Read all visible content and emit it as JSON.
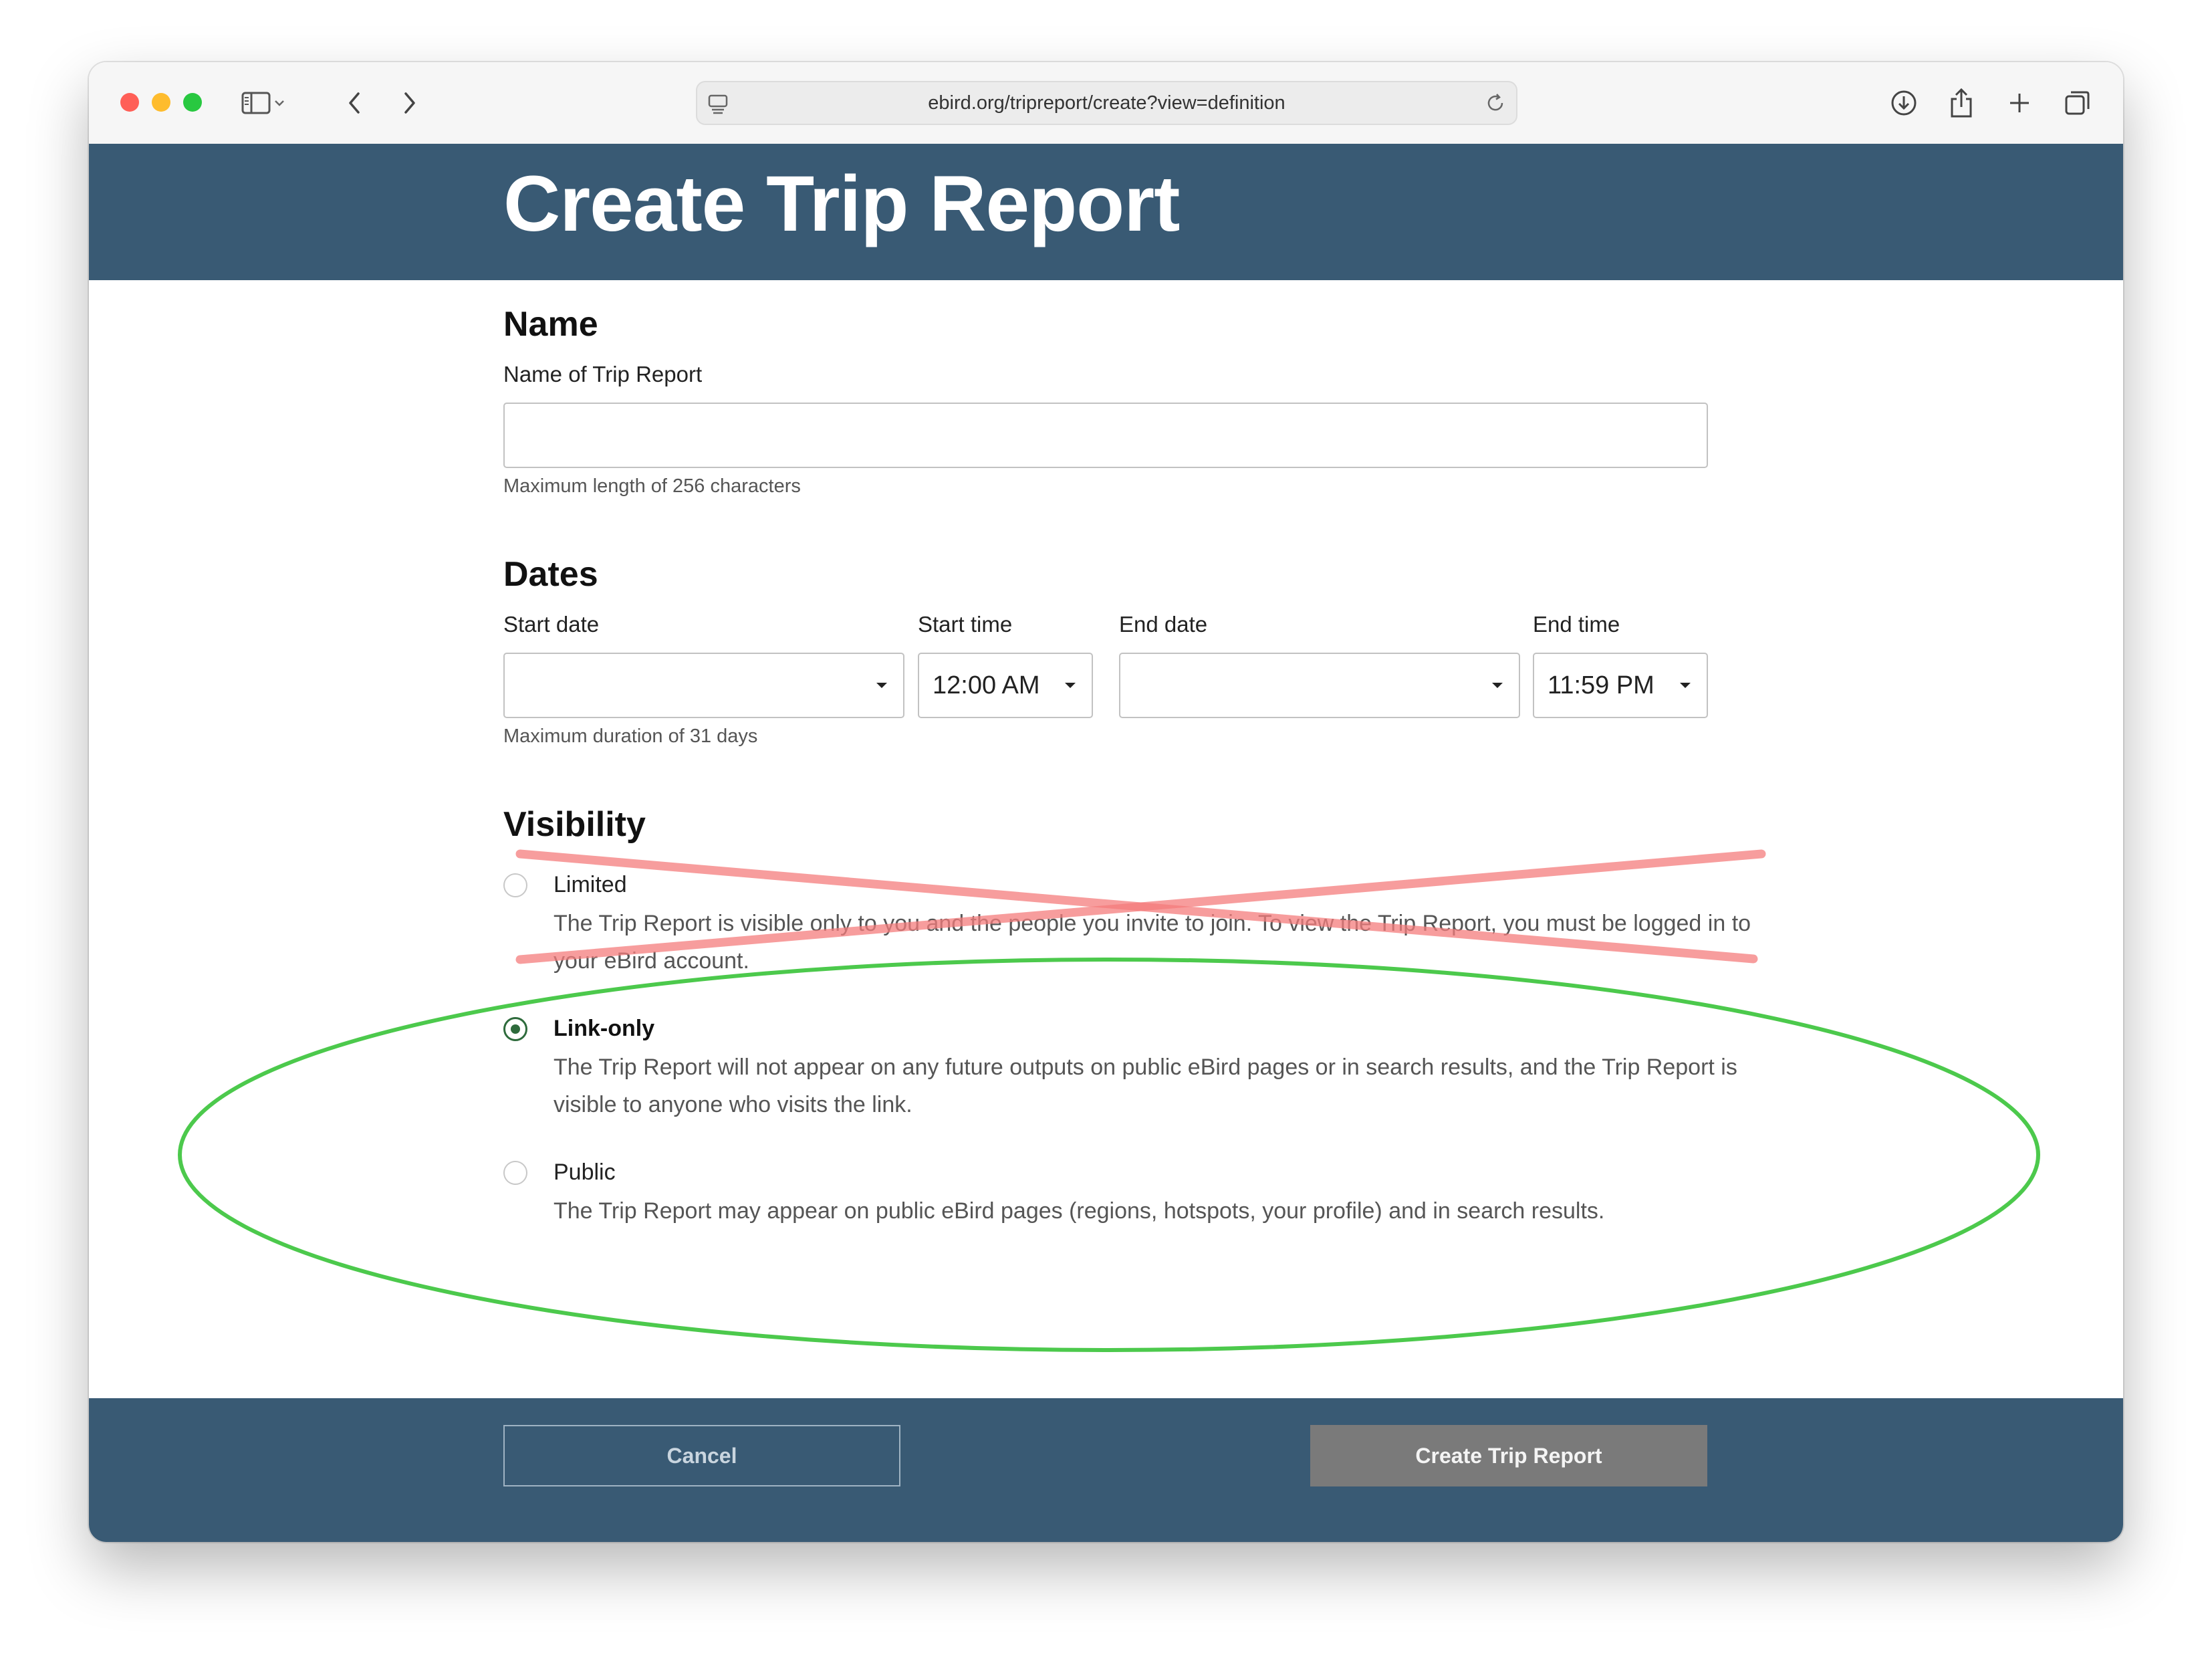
{
  "browser": {
    "url": "ebird.org/tripreport/create?view=definition"
  },
  "page": {
    "title": "Create Trip Report"
  },
  "name_section": {
    "heading": "Name",
    "field_label": "Name of Trip Report",
    "field_value": "",
    "hint": "Maximum length of 256 characters"
  },
  "dates_section": {
    "heading": "Dates",
    "start_date_label": "Start date",
    "start_date_value": "",
    "start_time_label": "Start time",
    "start_time_value": "12:00 AM",
    "end_date_label": "End date",
    "end_date_value": "",
    "end_time_label": "End time",
    "end_time_value": "11:59 PM",
    "hint": "Maximum duration of 31 days"
  },
  "visibility_section": {
    "heading": "Visibility",
    "selected": "Link-only",
    "options": [
      {
        "label": "Limited",
        "checked": false,
        "description": "The Trip Report is visible only to you and the people you invite to join. To view the Trip Report, you must be logged in to your eBird account."
      },
      {
        "label": "Link-only",
        "checked": true,
        "description": "The Trip Report will not appear on any future outputs on public eBird pages or in search results, and the Trip Report is visible to anyone who visits the link."
      },
      {
        "label": "Public",
        "checked": false,
        "description": "The Trip Report may appear on public eBird pages (regions, hotspots, your profile) and in search results."
      }
    ]
  },
  "footer": {
    "cancel_label": "Cancel",
    "create_label": "Create Trip Report"
  },
  "annotations": {
    "cross_out_color": "#f47c7c",
    "highlight_ellipse_color": "#4cc94c"
  },
  "colors": {
    "header_bg": "#395a74",
    "radio_accent": "#2e6b3c",
    "create_button_bg": "#7a7a7a"
  }
}
